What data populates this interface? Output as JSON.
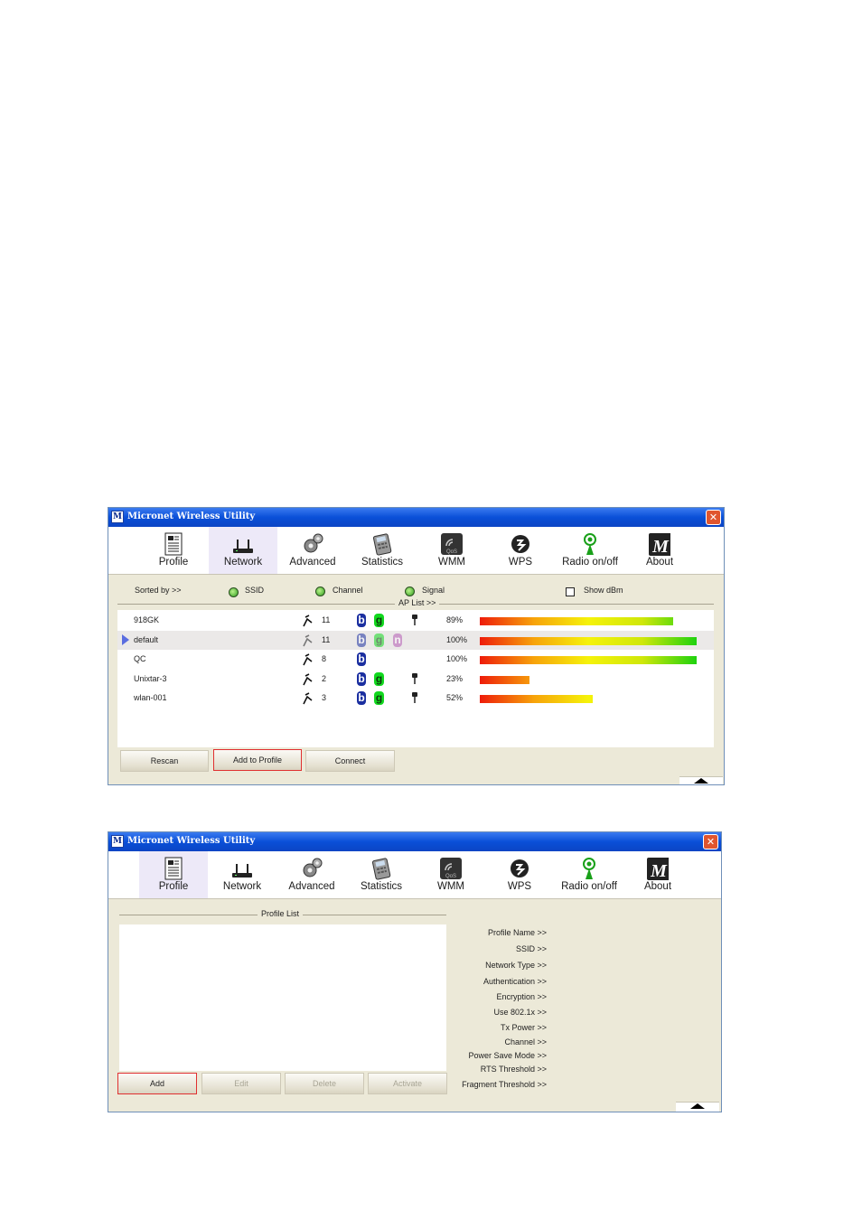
{
  "window1": {
    "title": "Micronet Wireless Utility",
    "toolbar": [
      {
        "label": "Profile",
        "icon": "profile-icon"
      },
      {
        "label": "Network",
        "icon": "network-icon"
      },
      {
        "label": "Advanced",
        "icon": "advanced-icon"
      },
      {
        "label": "Statistics",
        "icon": "statistics-icon"
      },
      {
        "label": "WMM",
        "icon": "wmm-icon"
      },
      {
        "label": "WPS",
        "icon": "wps-icon"
      },
      {
        "label": "Radio on/off",
        "icon": "radio-icon"
      },
      {
        "label": "About",
        "icon": "about-icon"
      }
    ],
    "active_tab": "Network",
    "sort": {
      "label": "Sorted by >>",
      "ssid": "SSID",
      "channel": "Channel",
      "signal": "Signal",
      "show_dbm": "Show dBm"
    },
    "ap_list_title": "AP List >>",
    "ap_list": [
      {
        "ssid": "918GK",
        "channel": "11",
        "modes": [
          "b",
          "g"
        ],
        "secure": true,
        "signal_pct": 89,
        "signal": "89%"
      },
      {
        "ssid": "default",
        "channel": "11",
        "modes": [
          "b",
          "g",
          "n"
        ],
        "secure": false,
        "signal_pct": 100,
        "signal": "100%",
        "selected": true
      },
      {
        "ssid": "QC",
        "channel": "8",
        "modes": [
          "b"
        ],
        "secure": false,
        "signal_pct": 100,
        "signal": "100%"
      },
      {
        "ssid": "Unixtar-3",
        "channel": "2",
        "modes": [
          "b",
          "g"
        ],
        "secure": true,
        "signal_pct": 23,
        "signal": "23%"
      },
      {
        "ssid": "wlan-001",
        "channel": "3",
        "modes": [
          "b",
          "g"
        ],
        "secure": true,
        "signal_pct": 52,
        "signal": "52%"
      }
    ],
    "buttons": {
      "rescan": "Rescan",
      "add_to_profile": "Add to Profile",
      "connect": "Connect"
    }
  },
  "window2": {
    "title": "Micronet Wireless Utility",
    "active_tab": "Profile",
    "profile_list_title": "Profile List",
    "buttons": {
      "add": "Add",
      "edit": "Edit",
      "delete": "Delete",
      "activate": "Activate"
    },
    "details": [
      "Profile Name >>",
      "SSID >>",
      "Network Type >>",
      "Authentication >>",
      "Encryption >>",
      "Use 802.1x >>",
      "Tx Power >>",
      "Channel >>",
      "Power Save Mode >>",
      "RTS Threshold >>",
      "Fragment Threshold >>"
    ]
  },
  "colors": {
    "titlebar": "#0a4fd8",
    "active_tab": "#ede9f8",
    "window_bg": "#ece9d8",
    "focus_border": "#e03030"
  }
}
